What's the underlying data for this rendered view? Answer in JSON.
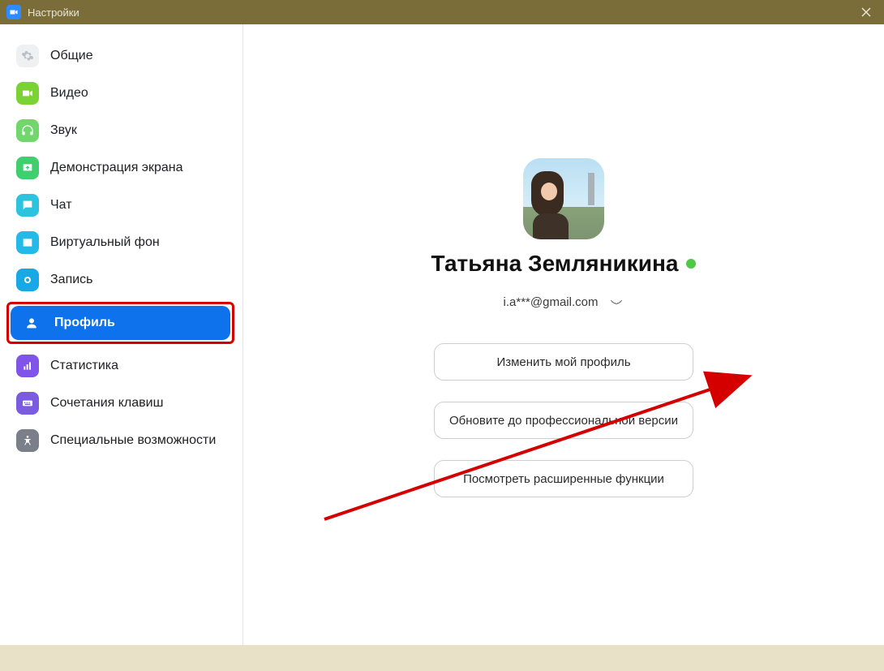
{
  "titlebar": {
    "title": "Настройки"
  },
  "sidebar": {
    "items": [
      {
        "id": "general",
        "label": "Общие"
      },
      {
        "id": "video",
        "label": "Видео"
      },
      {
        "id": "audio",
        "label": "Звук"
      },
      {
        "id": "share",
        "label": "Демонстрация экрана"
      },
      {
        "id": "chat",
        "label": "Чат"
      },
      {
        "id": "vbg",
        "label": "Виртуальный фон"
      },
      {
        "id": "record",
        "label": "Запись"
      },
      {
        "id": "profile",
        "label": "Профиль"
      },
      {
        "id": "stats",
        "label": "Статистика"
      },
      {
        "id": "keys",
        "label": "Сочетания клавиш"
      },
      {
        "id": "accessibility",
        "label": "Специальные возможности"
      }
    ],
    "active_id": "profile"
  },
  "profile": {
    "name": "Татьяна Земляникина",
    "email_masked": "i.a***@gmail.com",
    "status": "online",
    "buttons": {
      "edit": "Изменить мой профиль",
      "upgrade": "Обновите до профессиональной версии",
      "advanced": "Посмотреть расширенные функции"
    }
  },
  "colors": {
    "accent": "#0e72ed",
    "status_online": "#50c845",
    "annotation_red": "#d40000"
  }
}
